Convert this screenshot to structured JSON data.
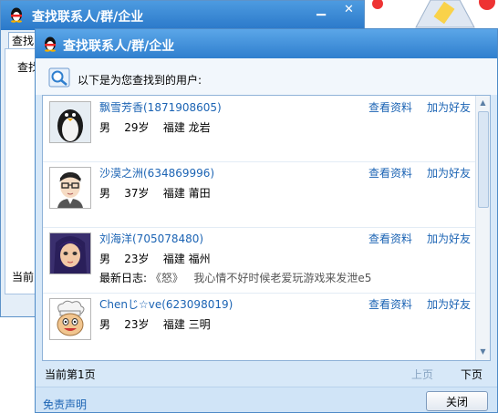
{
  "background_window": {
    "title": "查找联系人/群/企业",
    "tab_label": "查找",
    "body_label": "查找",
    "status_label": "当前"
  },
  "window": {
    "title": "查找联系人/群/企业",
    "header_text": "以下是为您查找到的用户:"
  },
  "colors": {
    "title_bar": "#2f7fce",
    "link": "#1c64b4",
    "panel_bg": "#d7e8f8"
  },
  "users": [
    {
      "name": "飘雪芳香(1871908605)",
      "gender": "男",
      "age": "29岁",
      "location": "福建 龙岩",
      "view_label": "查看资料",
      "add_label": "加为好友",
      "avatar_icon": "penguin-icon"
    },
    {
      "name": "沙漠之洲(634869996)",
      "gender": "男",
      "age": "37岁",
      "location": "福建 莆田",
      "view_label": "查看资料",
      "add_label": "加为好友",
      "avatar_icon": "glasses-man-icon"
    },
    {
      "name": "刘海洋(705078480)",
      "gender": "男",
      "age": "23岁",
      "location": "福建 福州",
      "diary_label": "最新日志:",
      "diary_text": "《怒》   我心情不好时候老爱玩游戏来发泄e5",
      "view_label": "查看资料",
      "add_label": "加为好友",
      "avatar_icon": "anime-girl-icon"
    },
    {
      "name": "Chenじ☆ve(623098019)",
      "gender": "男",
      "age": "23岁",
      "location": "福建 三明",
      "view_label": "查看资料",
      "add_label": "加为好友",
      "avatar_icon": "chef-icon"
    }
  ],
  "pager": {
    "status": "当前第1页",
    "prev_label": "上页",
    "next_label": "下页"
  },
  "footer": {
    "disclaimer_label": "免责声明",
    "close_label": "关闭"
  }
}
